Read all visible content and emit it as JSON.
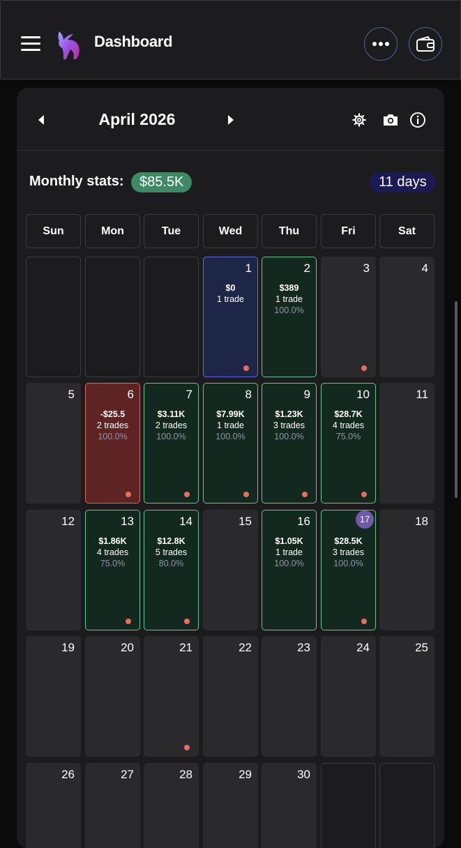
{
  "header": {
    "title": "Dashboard",
    "menu_icon": "hamburger-menu-icon",
    "logo_icon": "bull-logo-icon",
    "more_icon": "more-dots-icon",
    "wallet_icon": "wallet-icon"
  },
  "calendar": {
    "month": "April 2026",
    "prev_icon": "chevron-left-icon",
    "next_icon": "chevron-right-icon",
    "settings_icon": "gear-icon",
    "camera_icon": "camera-icon",
    "info_icon": "info-icon",
    "stats_label": "Monthly stats:",
    "stats_value": "$85.5K",
    "days_value": "11 days",
    "weekdays": [
      "Sun",
      "Mon",
      "Tue",
      "Wed",
      "Thu",
      "Fri",
      "Sat"
    ],
    "weeks": [
      [
        {
          "type": "empty"
        },
        {
          "type": "empty"
        },
        {
          "type": "empty"
        },
        {
          "day": "1",
          "type": "blue",
          "amount": "$0",
          "trades": "1 trade",
          "dot": true
        },
        {
          "day": "2",
          "type": "green",
          "amount": "$389",
          "trades": "1 trade",
          "pct": "100.0%"
        },
        {
          "day": "3",
          "type": "plain",
          "dot": true
        },
        {
          "day": "4",
          "type": "plain"
        }
      ],
      [
        {
          "day": "5",
          "type": "plain"
        },
        {
          "day": "6",
          "type": "red",
          "amount": "-$25.5",
          "trades": "2 trades",
          "pct": "100.0%",
          "dot": true
        },
        {
          "day": "7",
          "type": "green",
          "amount": "$3.11K",
          "trades": "2 trades",
          "pct": "100.0%",
          "dot": true
        },
        {
          "day": "8",
          "type": "green",
          "amount": "$7.99K",
          "trades": "1 trade",
          "pct": "100.0%",
          "dot": true
        },
        {
          "day": "9",
          "type": "green",
          "amount": "$1.23K",
          "trades": "3 trades",
          "pct": "100.0%",
          "dot": true
        },
        {
          "day": "10",
          "type": "green",
          "amount": "$28.7K",
          "trades": "4 trades",
          "pct": "75.0%",
          "dot": true
        },
        {
          "day": "11",
          "type": "plain"
        }
      ],
      [
        {
          "day": "12",
          "type": "plain"
        },
        {
          "day": "13",
          "type": "green",
          "amount": "$1.86K",
          "trades": "4 trades",
          "pct": "75.0%",
          "dot": true
        },
        {
          "day": "14",
          "type": "green",
          "amount": "$12.8K",
          "trades": "5 trades",
          "pct": "80.0%",
          "dot": true
        },
        {
          "day": "15",
          "type": "plain"
        },
        {
          "day": "16",
          "type": "green",
          "amount": "$1.05K",
          "trades": "1 trade",
          "pct": "100.0%"
        },
        {
          "day": "17",
          "type": "green",
          "today": true,
          "amount": "$28.5K",
          "trades": "3 trades",
          "pct": "100.0%",
          "dot": true
        },
        {
          "day": "18",
          "type": "plain"
        }
      ],
      [
        {
          "day": "19",
          "type": "plain"
        },
        {
          "day": "20",
          "type": "plain"
        },
        {
          "day": "21",
          "type": "plain",
          "dot": true
        },
        {
          "day": "22",
          "type": "plain"
        },
        {
          "day": "23",
          "type": "plain"
        },
        {
          "day": "24",
          "type": "plain"
        },
        {
          "day": "25",
          "type": "plain"
        }
      ],
      [
        {
          "day": "26",
          "type": "plain"
        },
        {
          "day": "27",
          "type": "plain"
        },
        {
          "day": "28",
          "type": "plain"
        },
        {
          "day": "29",
          "type": "plain"
        },
        {
          "day": "30",
          "type": "plain"
        },
        {
          "type": "empty"
        },
        {
          "type": "empty"
        }
      ]
    ]
  },
  "colors": {
    "profit_green": "#60c890",
    "loss_red": "#e06868",
    "today_purple": "#6e5aa8",
    "dot_red": "#e56d62"
  }
}
